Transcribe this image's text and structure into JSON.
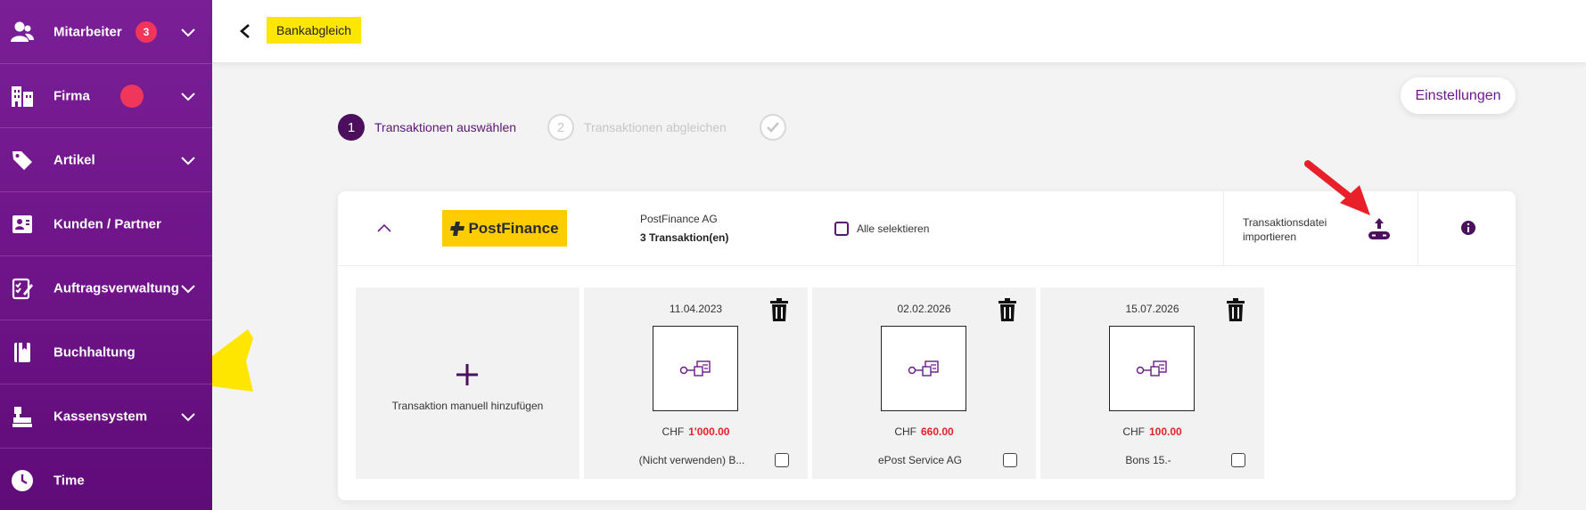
{
  "sidebar": {
    "items": [
      {
        "label": "Mitarbeiter",
        "icon": "users-icon",
        "badge": "3",
        "expandable": true
      },
      {
        "label": "Firma",
        "icon": "building-icon",
        "dot": true,
        "expandable": true
      },
      {
        "label": "Artikel",
        "icon": "tag-icon",
        "expandable": true
      },
      {
        "label": "Kunden / Partner",
        "icon": "contact-card-icon",
        "expandable": false
      },
      {
        "label": "Auftragsverwaltung",
        "icon": "clipboard-icon",
        "expandable": true
      },
      {
        "label": "Buchhaltung",
        "icon": "ledger-book-icon",
        "expandable": false
      },
      {
        "label": "Kassensystem",
        "icon": "cash-register-icon",
        "expandable": true
      },
      {
        "label": "Time",
        "icon": "clock-icon",
        "expandable": false
      }
    ]
  },
  "header": {
    "title": "Bankabgleich",
    "back_icon": "chevron-left-icon"
  },
  "settings_label": "Einstellungen",
  "stepper": [
    {
      "number": "1",
      "label": "Transaktionen auswählen",
      "state": "active"
    },
    {
      "number": "2",
      "label": "Transaktionen abgleichen",
      "state": "inactive"
    },
    {
      "number": "",
      "label": "",
      "state": "inactive",
      "icon": "check-icon"
    }
  ],
  "bank": {
    "logo_text": "PostFinance",
    "name": "PostFinance AG",
    "count": "3 Transaktion(en)",
    "select_all": "Alle selektieren",
    "import_label": "Transaktionsdatei importieren",
    "import_icon": "upload-icon",
    "info_icon": "info-icon",
    "add_label": "Transaktion manuell hinzufügen",
    "transactions": [
      {
        "date": "11.04.2023",
        "currency": "CHF",
        "amount": "1'000.00",
        "description": "(Nicht verwenden) B..."
      },
      {
        "date": "02.02.2026",
        "currency": "CHF",
        "amount": "660.00",
        "description": "ePost Service AG"
      },
      {
        "date": "15.07.2026",
        "currency": "CHF",
        "amount": "100.00",
        "description": "Bons 15.-"
      }
    ]
  },
  "colors": {
    "sidebar": "#6e1488",
    "accent": "#4b0f5e",
    "highlight": "#ffe600",
    "badge": "#f0365a",
    "amount": "#e8202a",
    "annotation_arrow": "#e8202a",
    "postfinance_yellow": "#ffcc00"
  }
}
